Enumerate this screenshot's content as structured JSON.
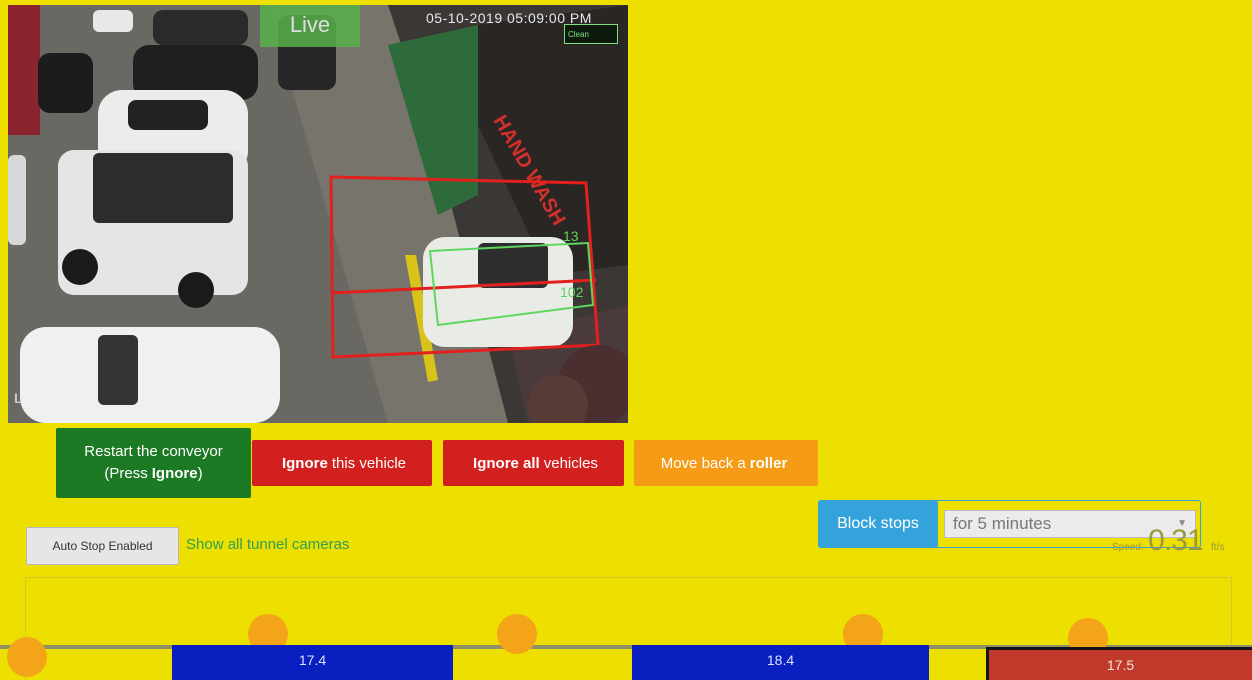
{
  "camera": {
    "live_label": "Live",
    "timestamp": "05-10-2019 05:09:00 PM",
    "status_text": "Clean",
    "brand": "LOREX",
    "overlay_numbers": [
      "13",
      "102"
    ]
  },
  "actions": {
    "restart": {
      "line1": "Restart the conveyor",
      "line2_prefix": "(Press",
      "line2_bold": "Ignore",
      "line2_suffix": ")"
    },
    "ignore_vehicle": {
      "bold": "Ignore",
      "text": "this vehicle"
    },
    "ignore_all": {
      "bold": "Ignore all",
      "text": "vehicles"
    },
    "move_back": {
      "text": "Move back a",
      "bold": "roller"
    }
  },
  "block": {
    "button_label": "Block stops",
    "selected": "for 5 minutes"
  },
  "speed": {
    "label": "Speed:",
    "value": "0.31",
    "unit": "ft/s"
  },
  "auto_stop_label": "Auto Stop Enabled",
  "show_cameras_link": "Show all tunnel cameras",
  "conveyor": {
    "vehicles": [
      {
        "value": "17.4",
        "color": "#0a1fc0"
      },
      {
        "value": "18.4",
        "color": "#0a1fc0"
      },
      {
        "value": "17.5",
        "color": "#bf3a2a"
      }
    ],
    "roller_color": "#f4a418"
  },
  "colors": {
    "background": "#eddf00",
    "restart": "#1d7a24",
    "ignore": "#d2201e",
    "move_back": "#f59b16",
    "block": "#35a3db"
  }
}
